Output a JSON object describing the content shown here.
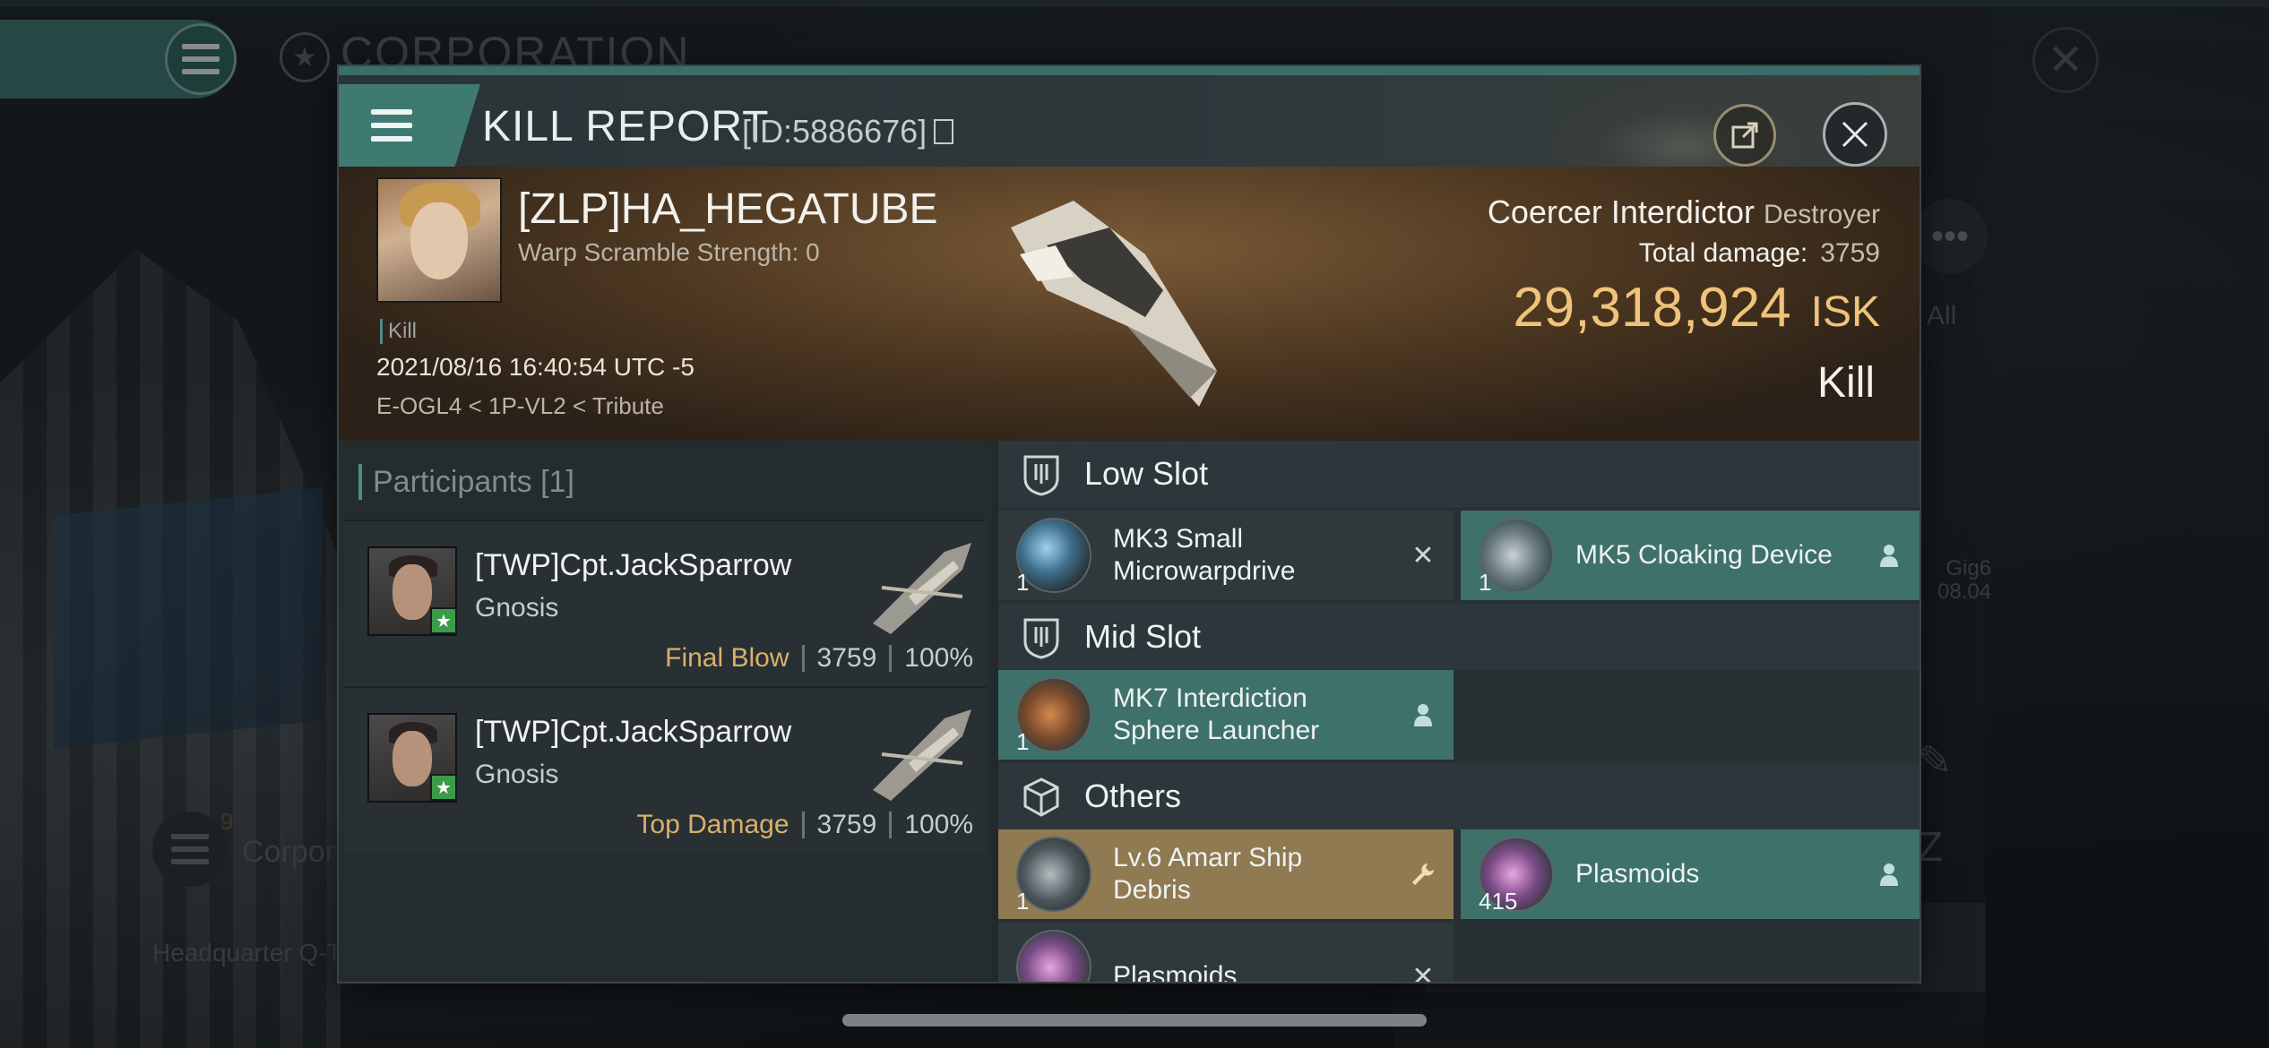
{
  "background": {
    "corporation_title": "CORPORATION",
    "corp_label": "Corpor",
    "corp_badge": "9",
    "hq_label": "Headquarter Q-T",
    "all_label": "All",
    "gig_label": "Gig6",
    "gig_date": "08.04"
  },
  "modal": {
    "title": "KILL REPORT",
    "report_id": "[ID:5886676]"
  },
  "victim": {
    "name": "[ZLP]HA_HEGATUBE",
    "warp_scramble": "Warp Scramble Strength: 0",
    "tag": "Kill",
    "timestamp": "2021/08/16 16:40:54 UTC -5",
    "location": "E-OGL4 < 1P-VL2 < Tribute",
    "ship_name": "Coercer Interdictor",
    "ship_class": "Destroyer",
    "total_damage_label": "Total damage:",
    "total_damage": "3759",
    "isk_value": "29,318,924",
    "isk_unit": "ISK",
    "result": "Kill"
  },
  "participants": {
    "header": "Participants",
    "count": "[1]",
    "rows": [
      {
        "name": "[TWP]Cpt.JackSparrow",
        "ship": "Gnosis",
        "label": "Final Blow",
        "damage": "3759",
        "percent": "100%"
      },
      {
        "name": "[TWP]Cpt.JackSparrow",
        "ship": "Gnosis",
        "label": "Top Damage",
        "damage": "3759",
        "percent": "100%"
      }
    ]
  },
  "slots": {
    "low_title": "Low Slot",
    "mid_title": "Mid Slot",
    "others_title": "Others",
    "items": [
      {
        "name": "MK3 Small Microwarpdrive",
        "qty": "1",
        "status": "destroyed"
      },
      {
        "name": "MK5 Cloaking Device",
        "qty": "1",
        "status": "dropped"
      },
      {
        "name": "MK7 Interdiction Sphere Launcher",
        "qty": "1",
        "status": "dropped"
      },
      {
        "name": "Lv.6 Amarr Ship Debris",
        "qty": "1",
        "status": "salvage"
      },
      {
        "name": "Plasmoids",
        "qty": "415",
        "status": "dropped"
      },
      {
        "name": "Plasmoids",
        "qty": "",
        "status": "destroyed"
      }
    ]
  },
  "colors": {
    "accent_teal": "#3e716a",
    "isk_gold": "#f0c37a",
    "salvage_gold": "#8f7a52"
  },
  "icons": {
    "menu": "hamburger-icon",
    "share": "share-icon",
    "close": "close-icon",
    "low_slot": "shield-slot-icon",
    "mid_slot": "shield-slot-icon",
    "others": "cube-icon",
    "destroyed": "x-mark-icon",
    "dropped": "person-icon",
    "salvage": "wrench-icon"
  }
}
